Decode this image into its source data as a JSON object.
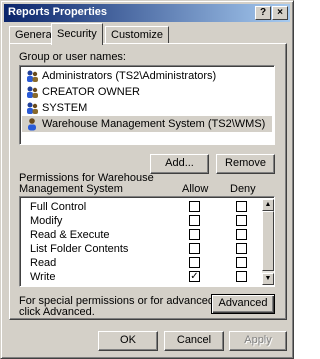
{
  "window": {
    "title": "Reports Properties",
    "help": "?",
    "close": "×"
  },
  "tabs": [
    {
      "label": "General"
    },
    {
      "label": "Security"
    },
    {
      "label": "Customize"
    }
  ],
  "group_label": "Group or user names:",
  "users": [
    {
      "name": "Administrators (TS2\\Administrators)"
    },
    {
      "name": "CREATOR OWNER"
    },
    {
      "name": "SYSTEM"
    },
    {
      "name": "Warehouse Management System (TS2\\WMS)"
    }
  ],
  "buttons": {
    "add": "Add...",
    "remove": "Remove",
    "advanced": "Advanced",
    "ok": "OK",
    "cancel": "Cancel",
    "apply": "Apply"
  },
  "permissions": {
    "label_line1": "Permissions for Warehouse",
    "label_line2": "Management System",
    "allow_header": "Allow",
    "deny_header": "Deny",
    "rows": [
      {
        "name": "Full Control",
        "allow": "",
        "deny": ""
      },
      {
        "name": "Modify",
        "allow": "",
        "deny": ""
      },
      {
        "name": "Read & Execute",
        "allow": "",
        "deny": ""
      },
      {
        "name": "List Folder Contents",
        "allow": "",
        "deny": ""
      },
      {
        "name": "Read",
        "allow": "",
        "deny": ""
      },
      {
        "name": "Write",
        "allow": "✓",
        "deny": ""
      }
    ]
  },
  "special_text_line1": "For special permissions or for advanced settings,",
  "special_text_line2": "click Advanced.",
  "scroll": {
    "up": "▲",
    "down": "▼"
  }
}
